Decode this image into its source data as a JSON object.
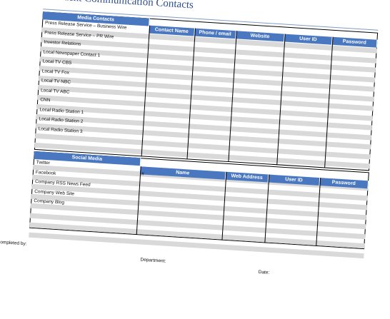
{
  "title": "Incident Communication Contacts",
  "media": {
    "section_header": "Media Contacts",
    "columns": [
      "Contact Name",
      "Phone / email",
      "Website",
      "User ID",
      "Password"
    ],
    "rows": [
      "Press Release Service – Business Wire",
      "Press Release Service – PR Wire",
      "Investor Relations",
      "Local Newspaper Contact 1",
      "Local TV CBS",
      "Local TV Fox",
      "Local TV NBC",
      "Local TV ABC",
      "CNN",
      "Local Radio Station 1",
      "Local Radio Station 2",
      "Local Radio Station 3"
    ]
  },
  "social": {
    "section_header": "Social Media",
    "columns": [
      "Name",
      "Web Address",
      "User ID",
      "Password"
    ],
    "hash": "#",
    "rows": [
      "Twitter",
      "Facebook",
      "Company RSS News Feed",
      "Company Web Site",
      "Company Blog"
    ]
  },
  "footer": {
    "completed_by": "Completed by:",
    "department": "Department:",
    "date": "Date:"
  },
  "colors": {
    "header_blue": "#4a78c0",
    "stripe_gray": "#d9d9d9",
    "title_blue": "#2f4f8f"
  }
}
